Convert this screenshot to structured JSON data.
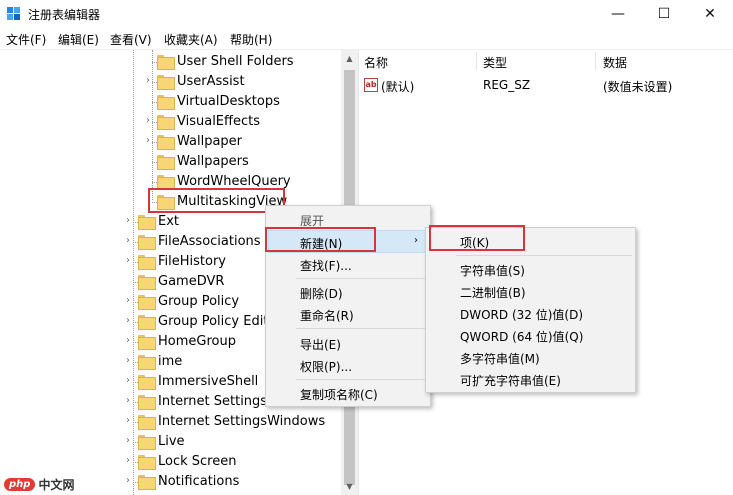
{
  "window": {
    "title": "注册表编辑器",
    "min": "—",
    "max": "☐",
    "close": "✕"
  },
  "menu": [
    "文件(F)",
    "编辑(E)",
    "查看(V)",
    "收藏夹(A)",
    "帮助(H)"
  ],
  "tree": {
    "items": [
      {
        "label": "User Shell Folders",
        "arrow": ""
      },
      {
        "label": "UserAssist",
        "arrow": "›"
      },
      {
        "label": "VirtualDesktops",
        "arrow": ""
      },
      {
        "label": "VisualEffects",
        "arrow": "›"
      },
      {
        "label": "Wallpaper",
        "arrow": "›"
      },
      {
        "label": "Wallpapers",
        "arrow": ""
      },
      {
        "label": "WordWheelQuery",
        "arrow": ""
      },
      {
        "label": "MultitaskingView",
        "arrow": ""
      },
      {
        "label": "Ext",
        "arrow": "›"
      },
      {
        "label": "FileAssociations",
        "arrow": "›"
      },
      {
        "label": "FileHistory",
        "arrow": "›"
      },
      {
        "label": "GameDVR",
        "arrow": ""
      },
      {
        "label": "Group Policy",
        "arrow": "›"
      },
      {
        "label": "Group Policy Editor",
        "arrow": "›"
      },
      {
        "label": "HomeGroup",
        "arrow": "›"
      },
      {
        "label": "ime",
        "arrow": "›"
      },
      {
        "label": "ImmersiveShell",
        "arrow": "›"
      },
      {
        "label": "Internet Settings",
        "arrow": "›"
      },
      {
        "label": "Internet SettingsWindows",
        "arrow": "›"
      },
      {
        "label": "Live",
        "arrow": "›"
      },
      {
        "label": "Lock Screen",
        "arrow": "›"
      },
      {
        "label": "Notifications",
        "arrow": "›"
      }
    ]
  },
  "list": {
    "headers": {
      "name": "名称",
      "type": "类型",
      "data": "数据"
    },
    "rows": [
      {
        "icon": "ab",
        "name": "(默认)",
        "type": "REG_SZ",
        "data": "(数值未设置)"
      }
    ]
  },
  "context_menu": {
    "header": "展开",
    "items": [
      "新建(N)",
      "查找(F)...",
      "删除(D)",
      "重命名(R)",
      "导出(E)",
      "权限(P)...",
      "复制项名称(C)"
    ],
    "submenu_arrow": "›"
  },
  "submenu": {
    "items": [
      "项(K)",
      "字符串值(S)",
      "二进制值(B)",
      "DWORD (32 位)值(D)",
      "QWORD (64 位)值(Q)",
      "多字符串值(M)",
      "可扩充字符串值(E)"
    ]
  },
  "watermark": {
    "badge": "php",
    "text": "中文网"
  },
  "scroll": {
    "up": "▲",
    "down": "▼"
  }
}
